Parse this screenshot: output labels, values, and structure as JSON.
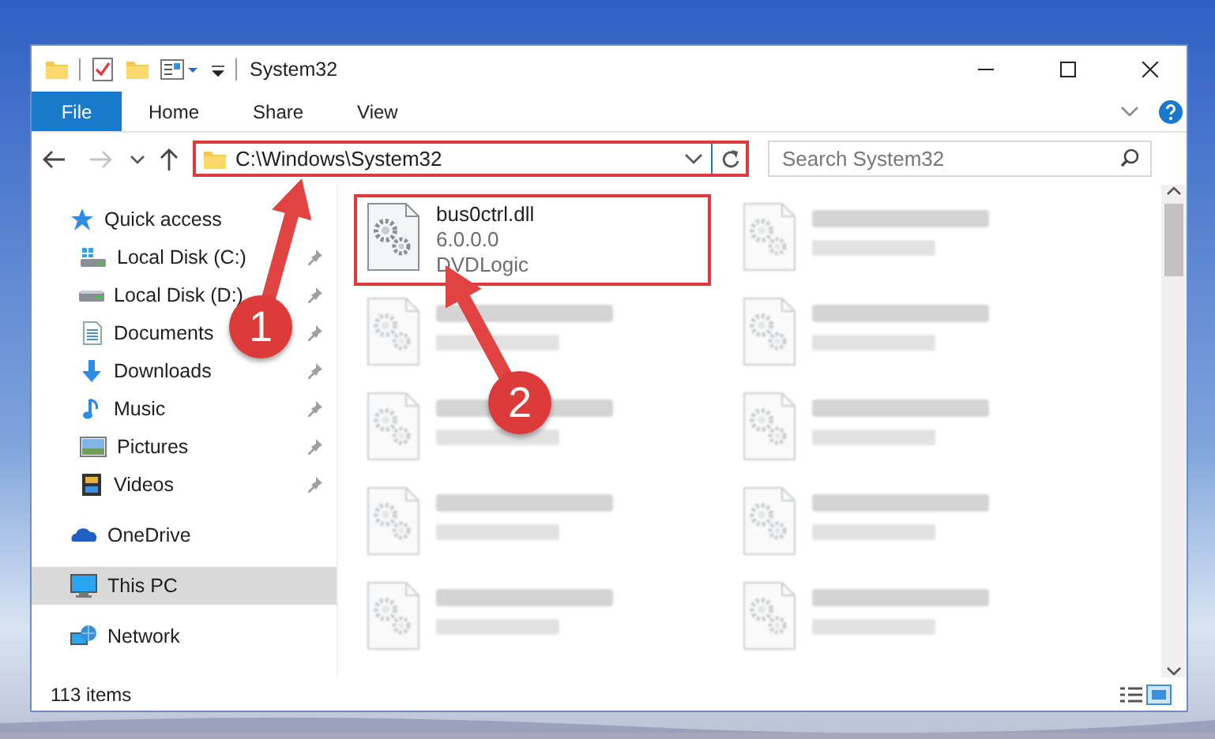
{
  "window": {
    "title": "System32"
  },
  "ribbon": {
    "tabs": [
      {
        "label": "File",
        "kind": "file"
      },
      {
        "label": "Home",
        "kind": "tab"
      },
      {
        "label": "Share",
        "kind": "tab"
      },
      {
        "label": "View",
        "kind": "tab"
      }
    ]
  },
  "address_bar": {
    "value": "C:\\Windows\\System32",
    "highlighted": true
  },
  "search": {
    "placeholder": "Search System32"
  },
  "navigation": [
    {
      "label": "Quick access",
      "kind": "star",
      "selected": false,
      "children": [
        {
          "label": "Local Disk (C:)",
          "kind": "system-drive",
          "pinned": true,
          "selected": false
        },
        {
          "label": "Local Disk (D:)",
          "kind": "drive",
          "pinned": true,
          "selected": false
        },
        {
          "label": "Documents",
          "kind": "documents",
          "pinned": true,
          "selected": false
        },
        {
          "label": "Downloads",
          "kind": "downloads",
          "pinned": true,
          "selected": false
        },
        {
          "label": "Music",
          "kind": "music",
          "pinned": true,
          "selected": false
        },
        {
          "label": "Pictures",
          "kind": "pictures",
          "pinned": true,
          "selected": false
        },
        {
          "label": "Videos",
          "kind": "videos",
          "pinned": true,
          "selected": false
        }
      ]
    },
    {
      "label": "OneDrive",
      "kind": "cloud",
      "selected": false
    },
    {
      "label": "This PC",
      "kind": "computer",
      "selected": true
    },
    {
      "label": "Network",
      "kind": "network",
      "selected": false
    }
  ],
  "files": [
    {
      "name": "bus0ctrl.dll",
      "details": [
        "6.0.0.0",
        "DVDLogic"
      ],
      "highlighted": true,
      "blurred": false
    },
    {
      "highlighted": false,
      "blurred": true
    },
    {
      "highlighted": false,
      "blurred": true
    },
    {
      "highlighted": false,
      "blurred": true
    },
    {
      "highlighted": false,
      "blurred": true
    },
    {
      "highlighted": false,
      "blurred": true
    },
    {
      "highlighted": false,
      "blurred": true
    },
    {
      "highlighted": false,
      "blurred": true
    },
    {
      "highlighted": false,
      "blurred": true
    },
    {
      "highlighted": false,
      "blurred": true
    }
  ],
  "status_bar": {
    "item_count": "113 items"
  },
  "callouts": [
    {
      "number": "1"
    },
    {
      "number": "2"
    }
  ]
}
